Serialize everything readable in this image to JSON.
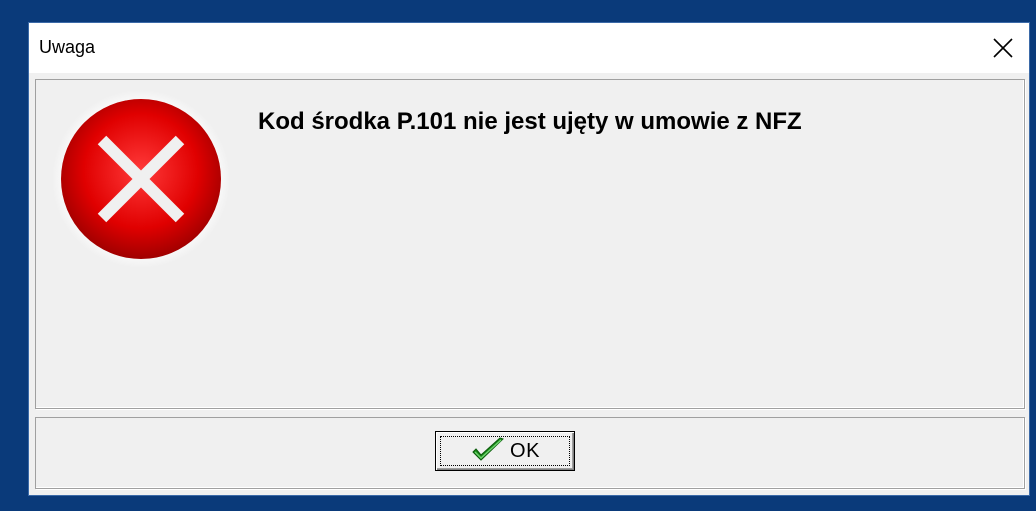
{
  "window": {
    "title": "Uwaga",
    "close_icon": "close-icon"
  },
  "message": {
    "text": "Kod środka P.101 nie jest ujęty w umowie z NFZ",
    "icon": "error-icon"
  },
  "buttons": {
    "ok_label": "OK",
    "ok_icon": "checkmark-icon"
  },
  "colors": {
    "desktop": "#0a3a7a",
    "dialog_bg": "#f0f0f0",
    "error_red": "#e00000",
    "check_green": "#1a8a1a"
  }
}
